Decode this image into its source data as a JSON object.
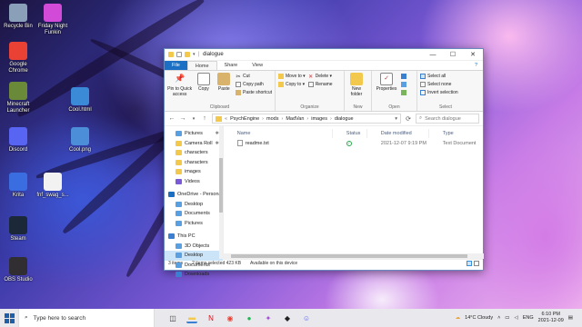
{
  "desktop": {
    "icons": [
      {
        "label": "Recycle Bin",
        "icon": "recycle-bin-icon",
        "color": "#8aa0b8"
      },
      {
        "label": "Google Chrome",
        "icon": "chrome-icon",
        "color": "#e94235"
      },
      {
        "label": "Minecraft Launcher",
        "icon": "minecraft-icon",
        "color": "#6a8a3a"
      },
      {
        "label": "Discord",
        "icon": "discord-icon",
        "color": "#5865f2"
      },
      {
        "label": "Krita",
        "icon": "krita-icon",
        "color": "#3a6ee0"
      },
      {
        "label": "Steam",
        "icon": "steam-icon",
        "color": "#1b2838"
      },
      {
        "label": "OBS Studio",
        "icon": "obs-icon",
        "color": "#302e31"
      },
      {
        "label": "Friday Night Funkin",
        "icon": "game-icon",
        "color": "#d14bd8"
      },
      {
        "label": "Cool.html",
        "icon": "html-file-icon",
        "color": "#3a8ad8"
      },
      {
        "label": "Cool.png",
        "icon": "image-file-icon",
        "color": "#4c8fd8"
      },
      {
        "label": "fnf_swag_s...",
        "icon": "file-icon",
        "color": "#f2f2f2"
      }
    ]
  },
  "window": {
    "title": "dialogue",
    "controls": {
      "minimize": "—",
      "maximize": "☐",
      "close": "✕"
    },
    "tabs": [
      "File",
      "Home",
      "Share",
      "View"
    ],
    "help": "?",
    "ribbon": {
      "clipboard": {
        "label": "Clipboard",
        "pin": "Pin to Quick access",
        "copy": "Copy",
        "paste": "Paste",
        "cut": "Cut",
        "copy_path": "Copy path",
        "paste_shortcut": "Paste shortcut"
      },
      "organize": {
        "label": "Organize",
        "move_to": "Move to ▾",
        "copy_to": "Copy to ▾",
        "delete": "Delete ▾",
        "rename": "Rename"
      },
      "new": {
        "label": "New",
        "new_folder": "New folder"
      },
      "open": {
        "label": "Open",
        "properties": "Properties"
      },
      "select": {
        "label": "Select",
        "select_all": "Select all",
        "select_none": "Select none",
        "invert": "Invert selection"
      }
    },
    "address": {
      "segments": [
        "PsychEngine",
        "mods",
        "MadVan",
        "images",
        "dialogue"
      ],
      "search_placeholder": "Search dialogue"
    },
    "nav": [
      {
        "label": "Pictures",
        "level": 2,
        "pinned": true,
        "color": "#5aa0e0"
      },
      {
        "label": "Camera Roll",
        "level": 2,
        "pinned": true,
        "color": "#f2c94c"
      },
      {
        "label": "characters",
        "level": 2,
        "pinned": false,
        "color": "#f2c94c"
      },
      {
        "label": "characters",
        "level": 2,
        "pinned": false,
        "color": "#f2c94c"
      },
      {
        "label": "images",
        "level": 2,
        "pinned": false,
        "color": "#f2c94c"
      },
      {
        "label": "Videos",
        "level": 2,
        "pinned": false,
        "color": "#7a5ad8"
      },
      {
        "label": "OneDrive - Persona",
        "level": 1,
        "pinned": false,
        "color": "#1c6fc2"
      },
      {
        "label": "Desktop",
        "level": 2,
        "pinned": false,
        "color": "#5aa0e0"
      },
      {
        "label": "Documents",
        "level": 2,
        "pinned": false,
        "color": "#5aa0e0"
      },
      {
        "label": "Pictures",
        "level": 2,
        "pinned": false,
        "color": "#5aa0e0"
      },
      {
        "label": "This PC",
        "level": 1,
        "pinned": false,
        "color": "#3b7fd1"
      },
      {
        "label": "3D Objects",
        "level": 2,
        "pinned": false,
        "color": "#5aa0e0"
      },
      {
        "label": "Desktop",
        "level": 2,
        "pinned": false,
        "color": "#5aa0e0",
        "selected": true
      },
      {
        "label": "Documents",
        "level": 2,
        "pinned": false,
        "color": "#5aa0e0"
      },
      {
        "label": "Downloads",
        "level": 2,
        "pinned": false,
        "color": "#3b7fd1"
      }
    ],
    "columns": {
      "name": "Name",
      "status": "Status",
      "date": "Date modified",
      "type": "Type"
    },
    "files": [
      {
        "name": "readme.txt",
        "status": "ok",
        "date": "2021-12-07 9:19 PM",
        "type": "Text Document"
      }
    ],
    "status": {
      "items": "3 items",
      "selected": "2 items selected  423 KB",
      "availability": "Available on this device"
    }
  },
  "taskbar": {
    "search_placeholder": "Type here to search",
    "apps": [
      {
        "icon": "task-view-icon",
        "glyph": "◫",
        "color": "#333333"
      },
      {
        "icon": "explorer-icon",
        "glyph": "▬",
        "color": "#f2c94c",
        "active": true
      },
      {
        "icon": "netflix-icon",
        "glyph": "N",
        "color": "#e50914"
      },
      {
        "icon": "chrome-icon",
        "glyph": "◉",
        "color": "#e94235"
      },
      {
        "icon": "spotify-icon",
        "glyph": "●",
        "color": "#1db954"
      },
      {
        "icon": "game-icon",
        "glyph": "✦",
        "color": "#a34dd8"
      },
      {
        "icon": "roblox-icon",
        "glyph": "◆",
        "color": "#222222"
      },
      {
        "icon": "discord-icon",
        "glyph": "☺",
        "color": "#5865f2"
      }
    ],
    "weather": "14°C  Cloudy",
    "lang": "ENG",
    "time": "6:10 PM",
    "date": "2021-12-09"
  }
}
